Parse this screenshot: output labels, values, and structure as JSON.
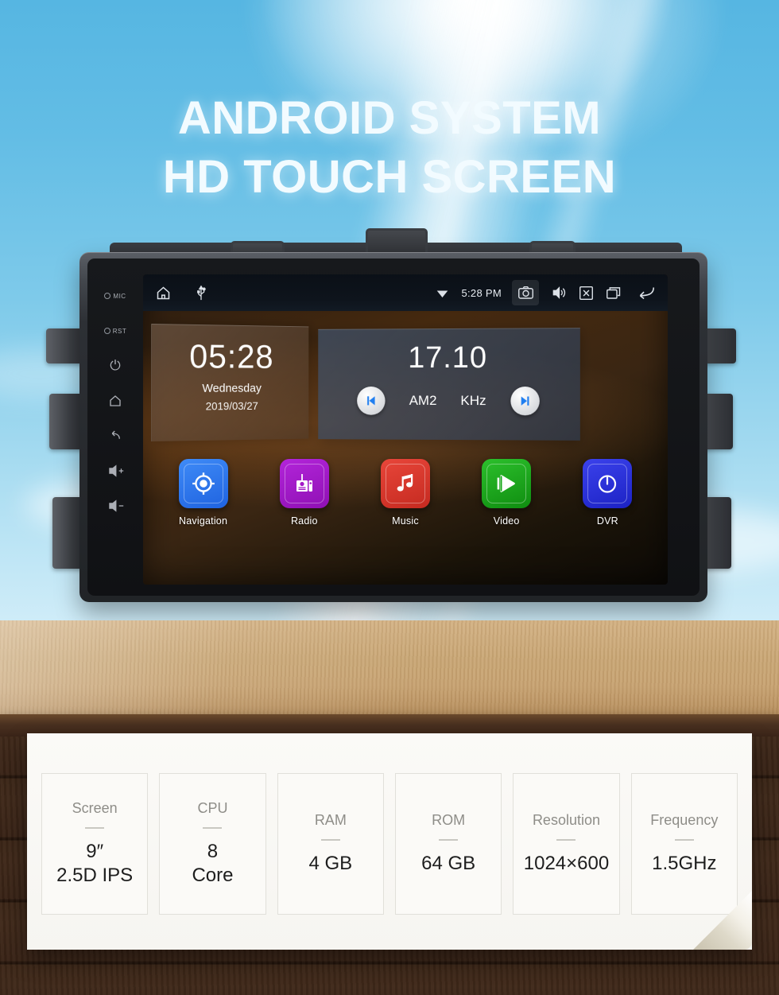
{
  "headline": {
    "line1": "ANDROID SYSTEM",
    "line2": "HD TOUCH SCREEN"
  },
  "device": {
    "side_buttons": [
      {
        "name": "mic-indicator",
        "label": "MIC"
      },
      {
        "name": "reset-indicator",
        "label": "RST"
      },
      {
        "name": "power-button",
        "label": "⏻"
      },
      {
        "name": "home-button",
        "label": "⌂"
      },
      {
        "name": "back-button",
        "label": "↩"
      },
      {
        "name": "volume-up-button",
        "label": "◁+"
      },
      {
        "name": "volume-down-button",
        "label": "◁-"
      }
    ],
    "statusbar": {
      "home_icon": "home-icon",
      "usb_icon": "usb-icon",
      "wifi_icon": "wifi-icon",
      "time": "5:28 PM",
      "camera_icon": "camera-icon",
      "volume_icon": "volume-icon",
      "close_icon": "close-icon",
      "recents_icon": "recents-icon",
      "back_icon": "back-icon"
    },
    "clock_widget": {
      "time": "05:28",
      "weekday": "Wednesday",
      "date": "2019/03/27"
    },
    "radio_widget": {
      "frequency": "17.10",
      "band": "AM2",
      "unit": "KHz",
      "prev_label": "⏮",
      "next_label": "⏭"
    },
    "apps": [
      {
        "label": "Navigation",
        "icon": "navigation-crosshair-icon",
        "color": "#2a7bf0"
      },
      {
        "label": "Radio",
        "icon": "radio-set-icon",
        "color": "#a317c7"
      },
      {
        "label": "Music",
        "icon": "music-note-icon",
        "color": "#d8352a"
      },
      {
        "label": "Video",
        "icon": "play-triangle-icon",
        "color": "#17a81a"
      },
      {
        "label": "DVR",
        "icon": "gauge-icon",
        "color": "#2b31dd"
      }
    ]
  },
  "specs": [
    {
      "title": "Screen",
      "value": "9″\n2.5D IPS"
    },
    {
      "title": "CPU",
      "value": "8\nCore"
    },
    {
      "title": "RAM",
      "value": "4 GB"
    },
    {
      "title": "ROM",
      "value": "64 GB"
    },
    {
      "title": "Resolution",
      "value": "1024×600"
    },
    {
      "title": "Frequency",
      "value": "1.5GHz"
    }
  ],
  "colors": {
    "sky": "#5bb8e2",
    "wood_top": "#c9a775",
    "wood_edge": "#3a2418",
    "paper": "#f7f6f2"
  }
}
